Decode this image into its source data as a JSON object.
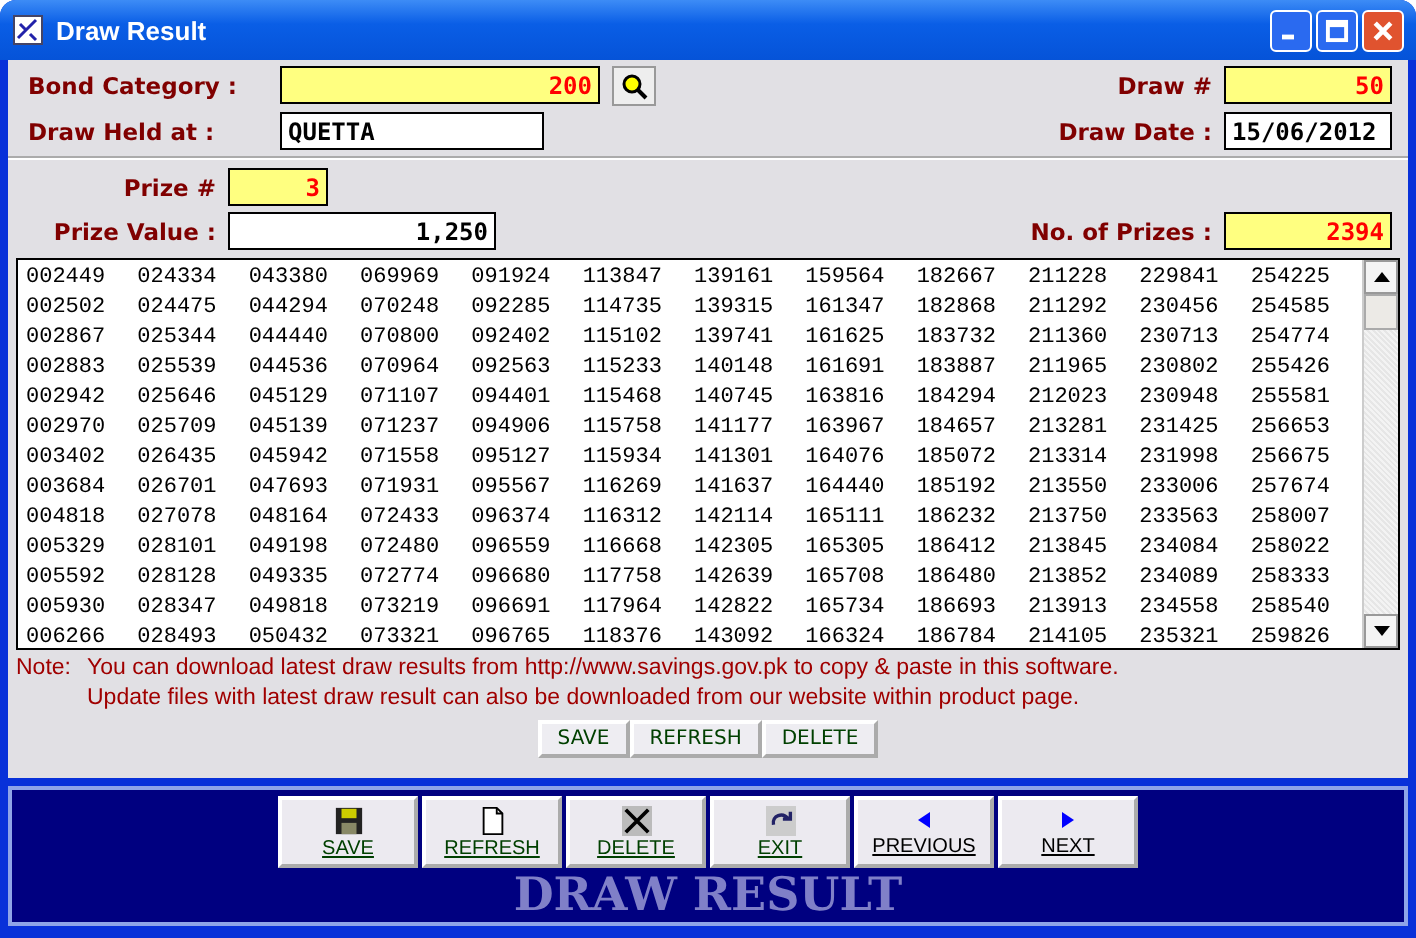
{
  "window": {
    "title": "Draw Result"
  },
  "header": {
    "bond_category": {
      "label": "Bond Category :",
      "value": "200"
    },
    "draw_number": {
      "label": "Draw #",
      "value": "50"
    },
    "draw_held_at": {
      "label": "Draw Held at :",
      "value": "QUETTA"
    },
    "draw_date": {
      "label": "Draw Date :",
      "value": "15/06/2012"
    }
  },
  "prize": {
    "prize_number": {
      "label": "Prize #",
      "value": "3"
    },
    "prize_value": {
      "label": "Prize Value :",
      "value": "1,250"
    },
    "number_of_prizes": {
      "label": "No. of Prizes :",
      "value": "2394"
    }
  },
  "results": {
    "rows": [
      [
        "002449",
        "024334",
        "043380",
        "069969",
        "091924",
        "113847",
        "139161",
        "159564",
        "182667",
        "211228",
        "229841",
        "254225"
      ],
      [
        "002502",
        "024475",
        "044294",
        "070248",
        "092285",
        "114735",
        "139315",
        "161347",
        "182868",
        "211292",
        "230456",
        "254585"
      ],
      [
        "002867",
        "025344",
        "044440",
        "070800",
        "092402",
        "115102",
        "139741",
        "161625",
        "183732",
        "211360",
        "230713",
        "254774"
      ],
      [
        "002883",
        "025539",
        "044536",
        "070964",
        "092563",
        "115233",
        "140148",
        "161691",
        "183887",
        "211965",
        "230802",
        "255426"
      ],
      [
        "002942",
        "025646",
        "045129",
        "071107",
        "094401",
        "115468",
        "140745",
        "163816",
        "184294",
        "212023",
        "230948",
        "255581"
      ],
      [
        "002970",
        "025709",
        "045139",
        "071237",
        "094906",
        "115758",
        "141177",
        "163967",
        "184657",
        "213281",
        "231425",
        "256653"
      ],
      [
        "003402",
        "026435",
        "045942",
        "071558",
        "095127",
        "115934",
        "141301",
        "164076",
        "185072",
        "213314",
        "231998",
        "256675"
      ],
      [
        "003684",
        "026701",
        "047693",
        "071931",
        "095567",
        "116269",
        "141637",
        "164440",
        "185192",
        "213550",
        "233006",
        "257674"
      ],
      [
        "004818",
        "027078",
        "048164",
        "072433",
        "096374",
        "116312",
        "142114",
        "165111",
        "186232",
        "213750",
        "233563",
        "258007"
      ],
      [
        "005329",
        "028101",
        "049198",
        "072480",
        "096559",
        "116668",
        "142305",
        "165305",
        "186412",
        "213845",
        "234084",
        "258022"
      ],
      [
        "005592",
        "028128",
        "049335",
        "072774",
        "096680",
        "117758",
        "142639",
        "165708",
        "186480",
        "213852",
        "234089",
        "258333"
      ],
      [
        "005930",
        "028347",
        "049818",
        "073219",
        "096691",
        "117964",
        "142822",
        "165734",
        "186693",
        "213913",
        "234558",
        "258540"
      ],
      [
        "006266",
        "028493",
        "050432",
        "073321",
        "096765",
        "118376",
        "143092",
        "166324",
        "186784",
        "214105",
        "235321",
        "259826"
      ]
    ]
  },
  "note": {
    "label": "Note:",
    "lines": [
      "You can download latest draw results from http://www.savings.gov.pk to copy & paste in this software.",
      "Update files with latest draw result can also be downloaded from our website within product page."
    ]
  },
  "list_buttons": [
    "SAVE",
    "REFRESH",
    "DELETE"
  ],
  "toolbar": {
    "buttons": [
      {
        "kind": "save",
        "label": "SAVE"
      },
      {
        "kind": "refresh",
        "label": "REFRESH"
      },
      {
        "kind": "delete",
        "label": "DELETE"
      },
      {
        "kind": "exit",
        "label": "EXIT"
      },
      {
        "kind": "previous",
        "label": "PREVIOUS"
      },
      {
        "kind": "next",
        "label": "NEXT"
      }
    ],
    "title": "DRAW RESULT"
  }
}
